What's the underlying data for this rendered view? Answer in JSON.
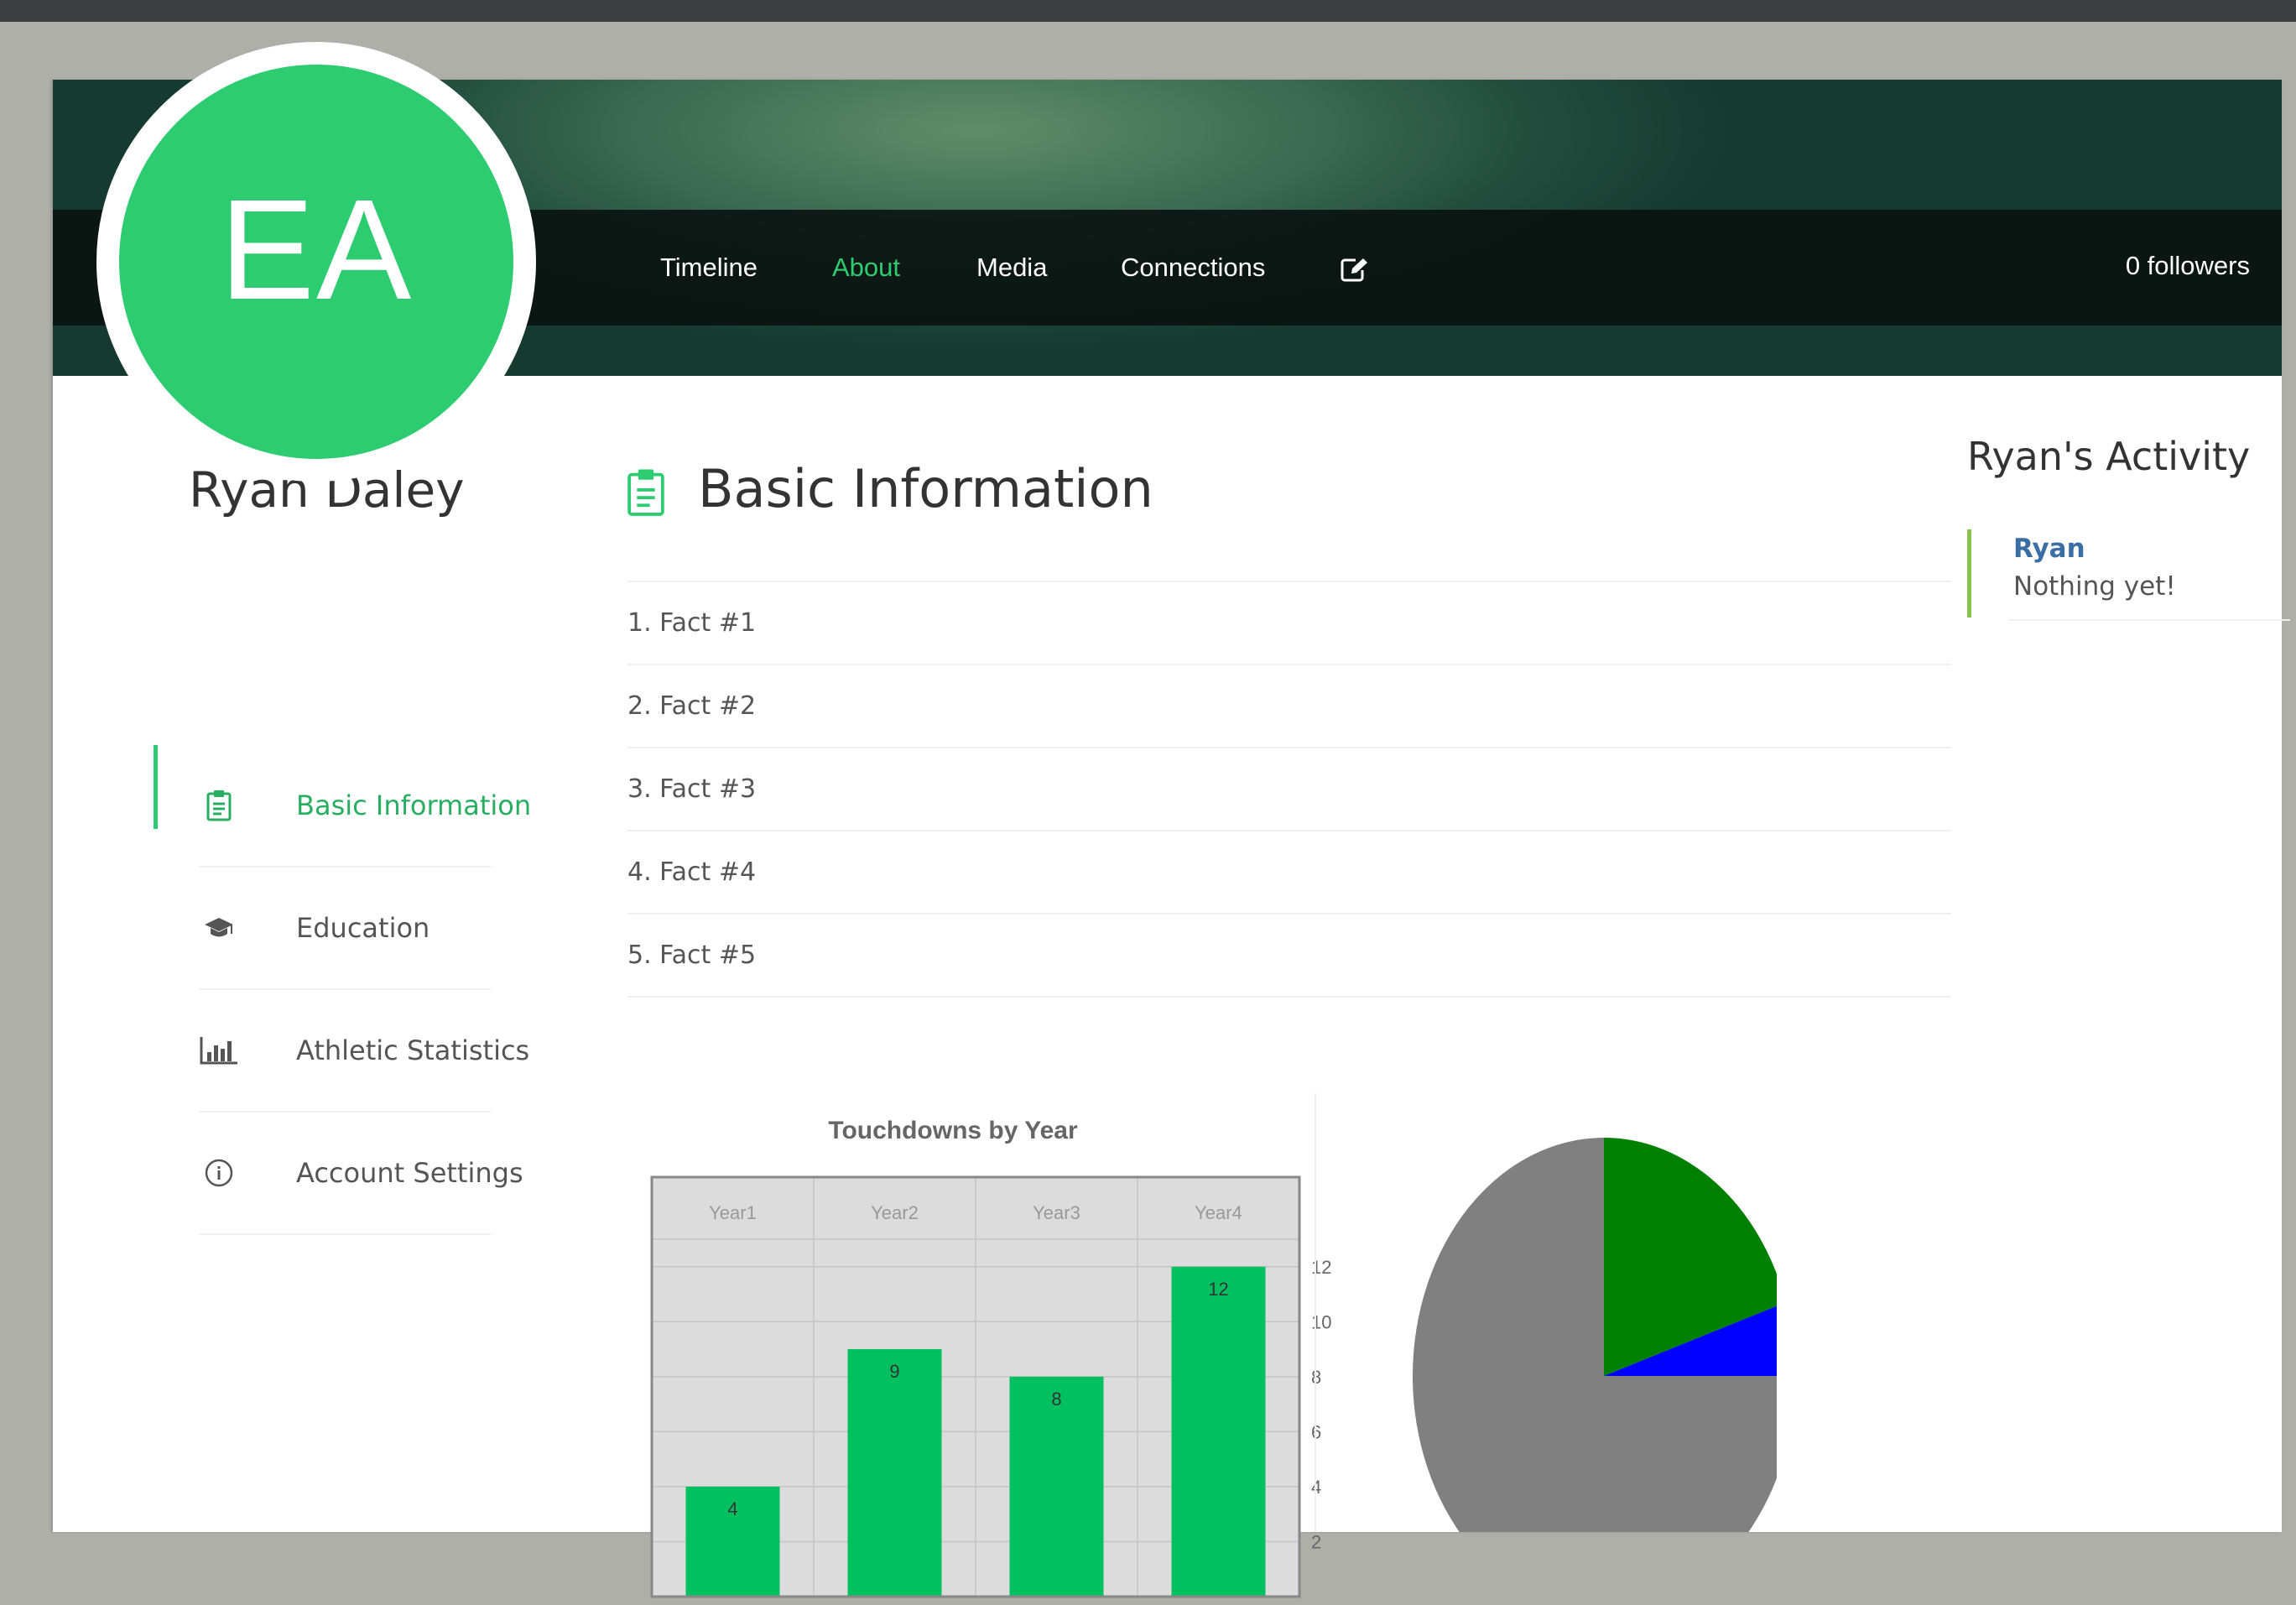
{
  "nav": {
    "items": [
      {
        "label": "Timeline"
      },
      {
        "label": "About"
      },
      {
        "label": "Media"
      },
      {
        "label": "Connections"
      }
    ],
    "followers": "0 followers"
  },
  "profile": {
    "initials": "EA",
    "name": "Ryan Daley"
  },
  "sidebar": {
    "items": [
      {
        "label": "Basic Information",
        "icon": "clipboard-icon",
        "active": true
      },
      {
        "label": "Education",
        "icon": "graduation-cap-icon",
        "active": false
      },
      {
        "label": "Athletic Statistics",
        "icon": "bar-chart-icon",
        "active": false
      },
      {
        "label": "Account Settings",
        "icon": "info-icon",
        "active": false
      }
    ]
  },
  "main": {
    "section_title": "Basic Information",
    "facts": [
      "1. Fact #1",
      "2. Fact #2",
      "3. Fact #3",
      "4. Fact #4",
      "5. Fact #5"
    ]
  },
  "activity": {
    "title": "Ryan's Activity",
    "entries": [
      {
        "name": "Ryan",
        "text": "Nothing yet!"
      }
    ]
  },
  "colors": {
    "accent": "#2ecc71",
    "bar": "#00c060",
    "pie": [
      "#808080",
      "#008000",
      "#0000ff"
    ]
  },
  "chart_data": [
    {
      "type": "bar",
      "title": "Touchdowns by Year",
      "categories": [
        "Year1",
        "Year2",
        "Year3",
        "Year4"
      ],
      "values": [
        4,
        9,
        8,
        12
      ],
      "yticks": [
        2,
        4,
        6,
        8,
        10,
        12
      ],
      "ylim": [
        0,
        13
      ],
      "grid": true,
      "xlabel": "",
      "ylabel": ""
    },
    {
      "type": "pie",
      "values": [
        75,
        20,
        5
      ],
      "colors": [
        "#808080",
        "#008000",
        "#0000ff"
      ]
    }
  ]
}
